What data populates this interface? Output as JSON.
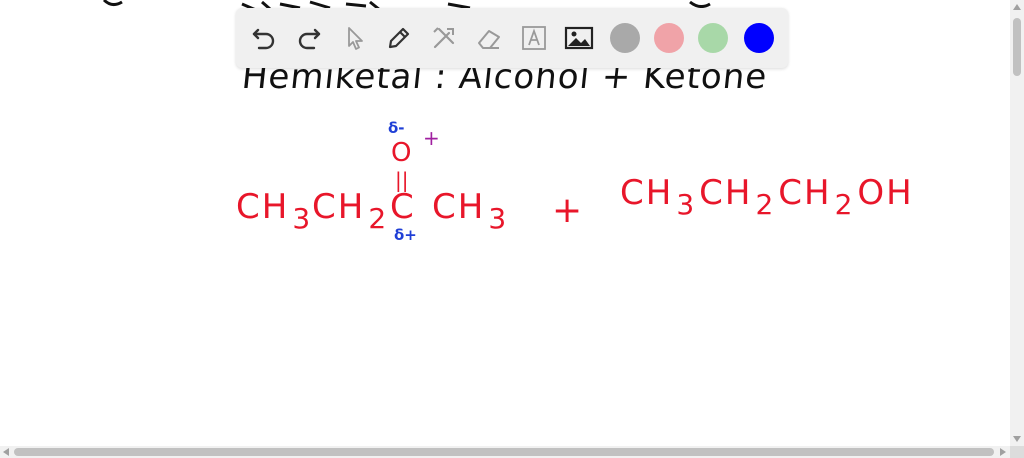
{
  "canvas": {
    "heading": "Hemiketal :   Alcohol  +  Ketone",
    "ketone": {
      "ch3_left": "CH",
      "ch3_left_sub": "3",
      "ch2": "CH",
      "ch2_sub": "2",
      "carbon": "C",
      "ch3_right": "CH",
      "ch3_right_sub": "3",
      "oxygen": "O",
      "double_bond": "||",
      "delta_minus": "δ-",
      "delta_plus": "δ+"
    },
    "plus_small": "+",
    "plus_main": "+",
    "alcohol": {
      "a1": "CH",
      "a1_sub": "3",
      "a2": "CH",
      "a2_sub": "2",
      "a3": "CH",
      "a3_sub": "2",
      "a4": "OH"
    }
  },
  "toolbar": {
    "tools": [
      {
        "name": "undo",
        "icon": "undo-icon"
      },
      {
        "name": "redo",
        "icon": "redo-icon"
      },
      {
        "name": "select",
        "icon": "pointer-icon"
      },
      {
        "name": "pen",
        "icon": "pen-icon"
      },
      {
        "name": "tools",
        "icon": "crossed-tools-icon"
      },
      {
        "name": "eraser",
        "icon": "eraser-icon"
      },
      {
        "name": "text",
        "icon": "text-box-icon",
        "label": "A"
      },
      {
        "name": "image",
        "icon": "image-icon"
      }
    ],
    "colors": [
      "#a9a9a9",
      "#f0a3a8",
      "#a8d8a8",
      "#0000ff"
    ]
  }
}
